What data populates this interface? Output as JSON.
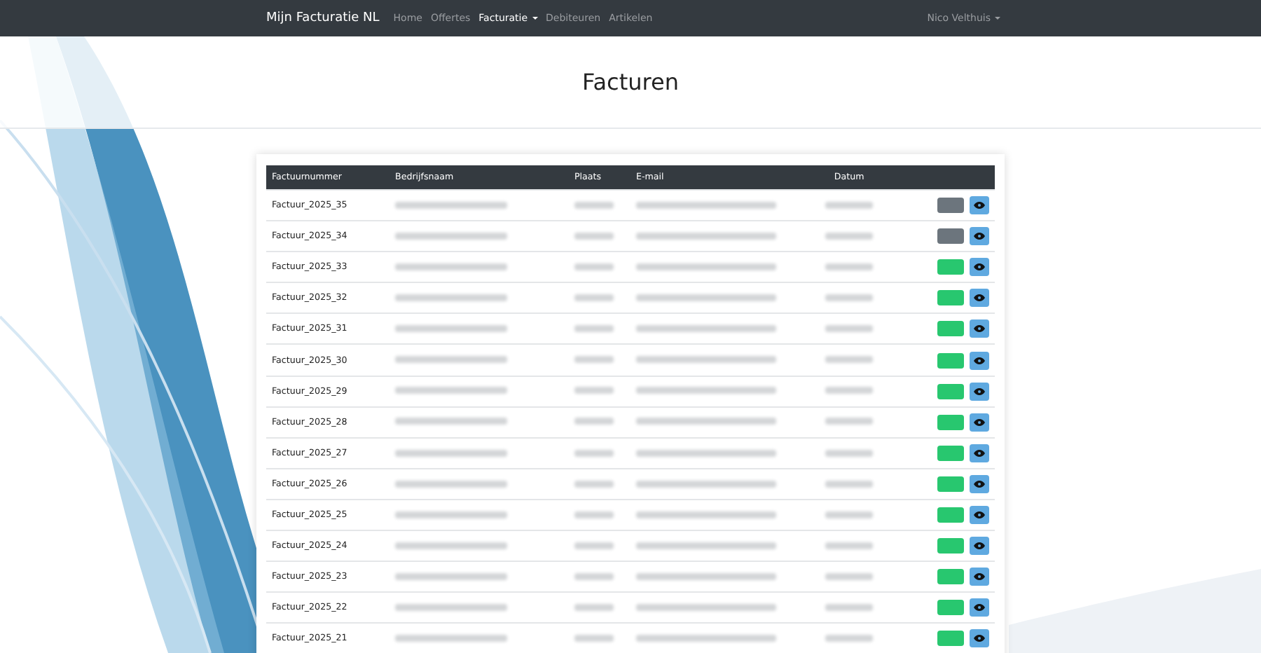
{
  "navbar": {
    "brand": "Mijn Facturatie NL",
    "links": [
      {
        "label": "Home",
        "selected": false,
        "dropdown": false
      },
      {
        "label": "Offertes",
        "selected": false,
        "dropdown": false
      },
      {
        "label": "Facturatie",
        "selected": true,
        "dropdown": true
      },
      {
        "label": "Debiteuren",
        "selected": false,
        "dropdown": false
      },
      {
        "label": "Artikelen",
        "selected": false,
        "dropdown": false
      }
    ],
    "user": "Nico Velthuis"
  },
  "title": "Facturen",
  "table": {
    "columns": [
      "Factuurnummer",
      "Bedrijfsnaam",
      "Plaats",
      "E-mail",
      "Datum"
    ],
    "rows": [
      {
        "number": "Factuur_2025_35",
        "color": "#6c757d"
      },
      {
        "number": "Factuur_2025_34",
        "color": "#6c757d"
      },
      {
        "number": "Factuur_2025_33",
        "color": "#28c76f"
      },
      {
        "number": "Factuur_2025_32",
        "color": "#28c76f"
      },
      {
        "number": "Factuur_2025_31",
        "color": "#28c76f"
      },
      {
        "number": "Factuur_2025_30",
        "color": "#28c76f"
      },
      {
        "number": "Factuur_2025_29",
        "color": "#28c76f"
      },
      {
        "number": "Factuur_2025_28",
        "color": "#28c76f"
      },
      {
        "number": "Factuur_2025_27",
        "color": "#28c76f"
      },
      {
        "number": "Factuur_2025_26",
        "color": "#28c76f"
      },
      {
        "number": "Factuur_2025_25",
        "color": "#28c76f"
      },
      {
        "number": "Factuur_2025_24",
        "color": "#28c76f"
      },
      {
        "number": "Factuur_2025_23",
        "color": "#28c76f"
      },
      {
        "number": "Factuur_2025_22",
        "color": "#28c76f"
      },
      {
        "number": "Factuur_2025_21",
        "color": "#28c76f"
      }
    ]
  }
}
